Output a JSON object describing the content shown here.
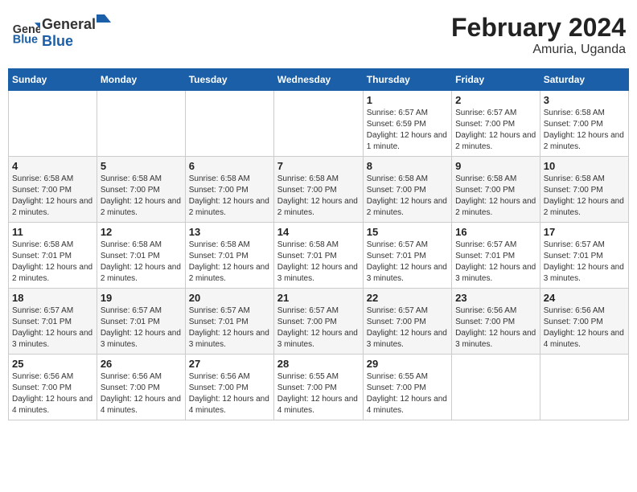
{
  "header": {
    "logo_general": "General",
    "logo_blue": "Blue",
    "main_title": "February 2024",
    "subtitle": "Amuria, Uganda"
  },
  "days_of_week": [
    "Sunday",
    "Monday",
    "Tuesday",
    "Wednesday",
    "Thursday",
    "Friday",
    "Saturday"
  ],
  "weeks": [
    {
      "days": [
        {
          "number": "",
          "info": ""
        },
        {
          "number": "",
          "info": ""
        },
        {
          "number": "",
          "info": ""
        },
        {
          "number": "",
          "info": ""
        },
        {
          "number": "1",
          "info": "Sunrise: 6:57 AM\nSunset: 6:59 PM\nDaylight: 12 hours and 1 minute."
        },
        {
          "number": "2",
          "info": "Sunrise: 6:57 AM\nSunset: 7:00 PM\nDaylight: 12 hours and 2 minutes."
        },
        {
          "number": "3",
          "info": "Sunrise: 6:58 AM\nSunset: 7:00 PM\nDaylight: 12 hours and 2 minutes."
        }
      ]
    },
    {
      "days": [
        {
          "number": "4",
          "info": "Sunrise: 6:58 AM\nSunset: 7:00 PM\nDaylight: 12 hours and 2 minutes."
        },
        {
          "number": "5",
          "info": "Sunrise: 6:58 AM\nSunset: 7:00 PM\nDaylight: 12 hours and 2 minutes."
        },
        {
          "number": "6",
          "info": "Sunrise: 6:58 AM\nSunset: 7:00 PM\nDaylight: 12 hours and 2 minutes."
        },
        {
          "number": "7",
          "info": "Sunrise: 6:58 AM\nSunset: 7:00 PM\nDaylight: 12 hours and 2 minutes."
        },
        {
          "number": "8",
          "info": "Sunrise: 6:58 AM\nSunset: 7:00 PM\nDaylight: 12 hours and 2 minutes."
        },
        {
          "number": "9",
          "info": "Sunrise: 6:58 AM\nSunset: 7:00 PM\nDaylight: 12 hours and 2 minutes."
        },
        {
          "number": "10",
          "info": "Sunrise: 6:58 AM\nSunset: 7:00 PM\nDaylight: 12 hours and 2 minutes."
        }
      ]
    },
    {
      "days": [
        {
          "number": "11",
          "info": "Sunrise: 6:58 AM\nSunset: 7:01 PM\nDaylight: 12 hours and 2 minutes."
        },
        {
          "number": "12",
          "info": "Sunrise: 6:58 AM\nSunset: 7:01 PM\nDaylight: 12 hours and 2 minutes."
        },
        {
          "number": "13",
          "info": "Sunrise: 6:58 AM\nSunset: 7:01 PM\nDaylight: 12 hours and 2 minutes."
        },
        {
          "number": "14",
          "info": "Sunrise: 6:58 AM\nSunset: 7:01 PM\nDaylight: 12 hours and 3 minutes."
        },
        {
          "number": "15",
          "info": "Sunrise: 6:57 AM\nSunset: 7:01 PM\nDaylight: 12 hours and 3 minutes."
        },
        {
          "number": "16",
          "info": "Sunrise: 6:57 AM\nSunset: 7:01 PM\nDaylight: 12 hours and 3 minutes."
        },
        {
          "number": "17",
          "info": "Sunrise: 6:57 AM\nSunset: 7:01 PM\nDaylight: 12 hours and 3 minutes."
        }
      ]
    },
    {
      "days": [
        {
          "number": "18",
          "info": "Sunrise: 6:57 AM\nSunset: 7:01 PM\nDaylight: 12 hours and 3 minutes."
        },
        {
          "number": "19",
          "info": "Sunrise: 6:57 AM\nSunset: 7:01 PM\nDaylight: 12 hours and 3 minutes."
        },
        {
          "number": "20",
          "info": "Sunrise: 6:57 AM\nSunset: 7:01 PM\nDaylight: 12 hours and 3 minutes."
        },
        {
          "number": "21",
          "info": "Sunrise: 6:57 AM\nSunset: 7:00 PM\nDaylight: 12 hours and 3 minutes."
        },
        {
          "number": "22",
          "info": "Sunrise: 6:57 AM\nSunset: 7:00 PM\nDaylight: 12 hours and 3 minutes."
        },
        {
          "number": "23",
          "info": "Sunrise: 6:56 AM\nSunset: 7:00 PM\nDaylight: 12 hours and 3 minutes."
        },
        {
          "number": "24",
          "info": "Sunrise: 6:56 AM\nSunset: 7:00 PM\nDaylight: 12 hours and 4 minutes."
        }
      ]
    },
    {
      "days": [
        {
          "number": "25",
          "info": "Sunrise: 6:56 AM\nSunset: 7:00 PM\nDaylight: 12 hours and 4 minutes."
        },
        {
          "number": "26",
          "info": "Sunrise: 6:56 AM\nSunset: 7:00 PM\nDaylight: 12 hours and 4 minutes."
        },
        {
          "number": "27",
          "info": "Sunrise: 6:56 AM\nSunset: 7:00 PM\nDaylight: 12 hours and 4 minutes."
        },
        {
          "number": "28",
          "info": "Sunrise: 6:55 AM\nSunset: 7:00 PM\nDaylight: 12 hours and 4 minutes."
        },
        {
          "number": "29",
          "info": "Sunrise: 6:55 AM\nSunset: 7:00 PM\nDaylight: 12 hours and 4 minutes."
        },
        {
          "number": "",
          "info": ""
        },
        {
          "number": "",
          "info": ""
        }
      ]
    }
  ]
}
